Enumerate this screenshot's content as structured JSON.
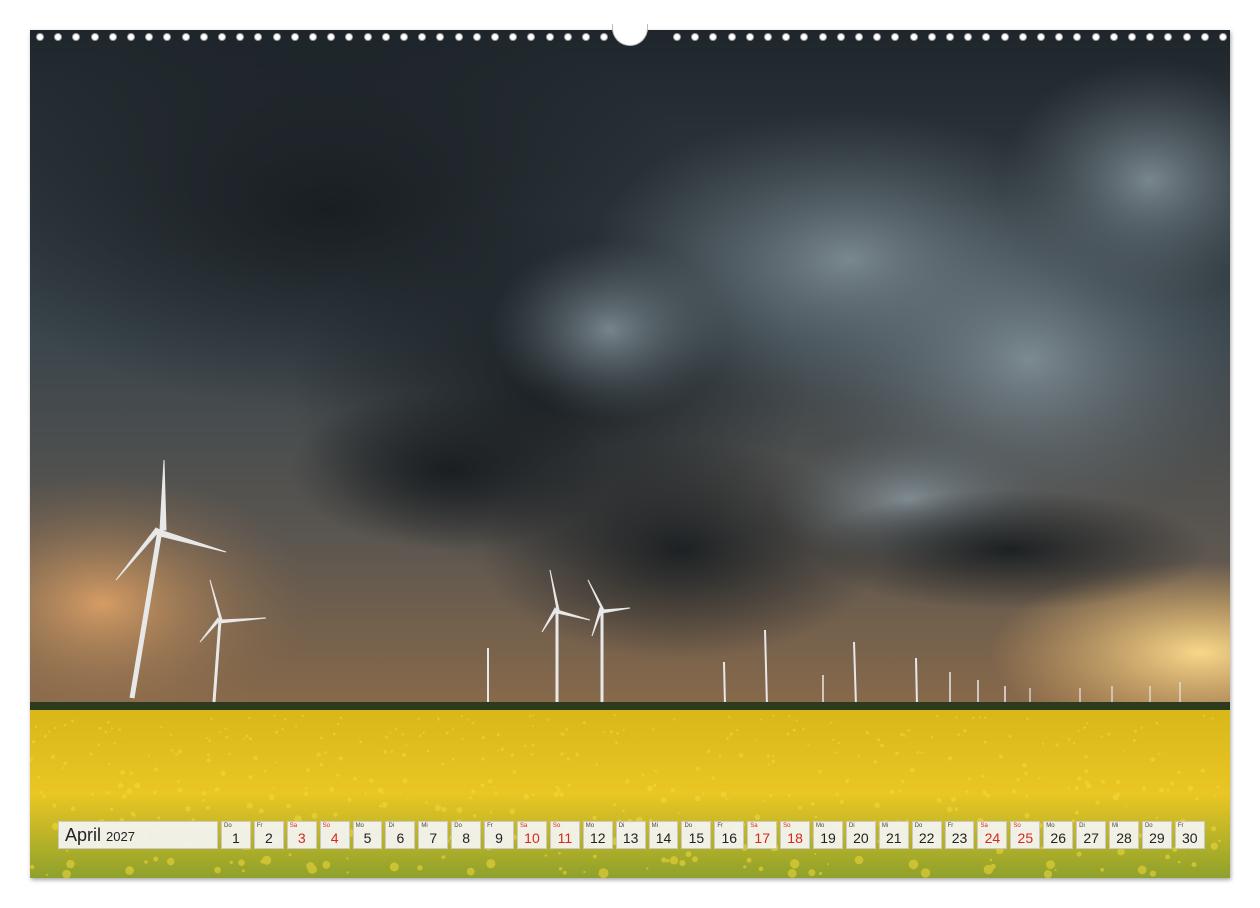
{
  "calendar": {
    "month": "April",
    "year": "2027",
    "weekend_color": "#d7261e",
    "days": [
      {
        "abbr": "Do",
        "num": "1",
        "weekend": false
      },
      {
        "abbr": "Fr",
        "num": "2",
        "weekend": false
      },
      {
        "abbr": "Sa",
        "num": "3",
        "weekend": true
      },
      {
        "abbr": "So",
        "num": "4",
        "weekend": true
      },
      {
        "abbr": "Mo",
        "num": "5",
        "weekend": false
      },
      {
        "abbr": "Di",
        "num": "6",
        "weekend": false
      },
      {
        "abbr": "Mi",
        "num": "7",
        "weekend": false
      },
      {
        "abbr": "Do",
        "num": "8",
        "weekend": false
      },
      {
        "abbr": "Fr",
        "num": "9",
        "weekend": false
      },
      {
        "abbr": "Sa",
        "num": "10",
        "weekend": true
      },
      {
        "abbr": "So",
        "num": "11",
        "weekend": true
      },
      {
        "abbr": "Mo",
        "num": "12",
        "weekend": false
      },
      {
        "abbr": "Di",
        "num": "13",
        "weekend": false
      },
      {
        "abbr": "Mi",
        "num": "14",
        "weekend": false
      },
      {
        "abbr": "Do",
        "num": "15",
        "weekend": false
      },
      {
        "abbr": "Fr",
        "num": "16",
        "weekend": false
      },
      {
        "abbr": "Sa",
        "num": "17",
        "weekend": true
      },
      {
        "abbr": "So",
        "num": "18",
        "weekend": true
      },
      {
        "abbr": "Mo",
        "num": "19",
        "weekend": false
      },
      {
        "abbr": "Di",
        "num": "20",
        "weekend": false
      },
      {
        "abbr": "Mi",
        "num": "21",
        "weekend": false
      },
      {
        "abbr": "Do",
        "num": "22",
        "weekend": false
      },
      {
        "abbr": "Fr",
        "num": "23",
        "weekend": false
      },
      {
        "abbr": "Sa",
        "num": "24",
        "weekend": true
      },
      {
        "abbr": "So",
        "num": "25",
        "weekend": true
      },
      {
        "abbr": "Mo",
        "num": "26",
        "weekend": false
      },
      {
        "abbr": "Di",
        "num": "27",
        "weekend": false
      },
      {
        "abbr": "Mi",
        "num": "28",
        "weekend": false
      },
      {
        "abbr": "Do",
        "num": "29",
        "weekend": false
      },
      {
        "abbr": "Fr",
        "num": "30",
        "weekend": false
      }
    ]
  },
  "photo": {
    "storm_color": "#2b3339",
    "sunset_color": "#f2c46a",
    "field_color": "#e6c21a"
  }
}
